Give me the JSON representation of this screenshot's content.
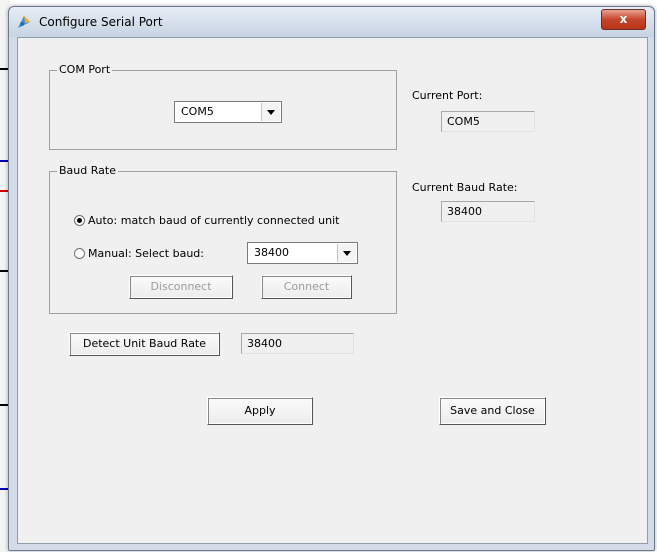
{
  "window": {
    "title": "Configure Serial Port",
    "close_label": "x"
  },
  "com_port": {
    "group_label": "COM Port",
    "selected": "COM5"
  },
  "current_port": {
    "label": "Current Port:",
    "value": "COM5"
  },
  "baud_rate": {
    "group_label": "Baud Rate",
    "auto_label": "Auto: match baud of currently connected unit",
    "manual_label": "Manual: Select baud:",
    "selected_mode": "auto",
    "manual_selected": "38400",
    "disconnect_label": "Disconnect",
    "connect_label": "Connect"
  },
  "current_baud": {
    "label": "Current Baud Rate:",
    "value": "38400"
  },
  "detect": {
    "button_label": "Detect Unit Baud Rate",
    "value": "38400"
  },
  "footer": {
    "apply_label": "Apply",
    "save_close_label": "Save and Close"
  },
  "colors": {
    "titlebar": "#c7d3e2",
    "client_bg": "#f0f0f0",
    "close_button": "#c7452c"
  }
}
